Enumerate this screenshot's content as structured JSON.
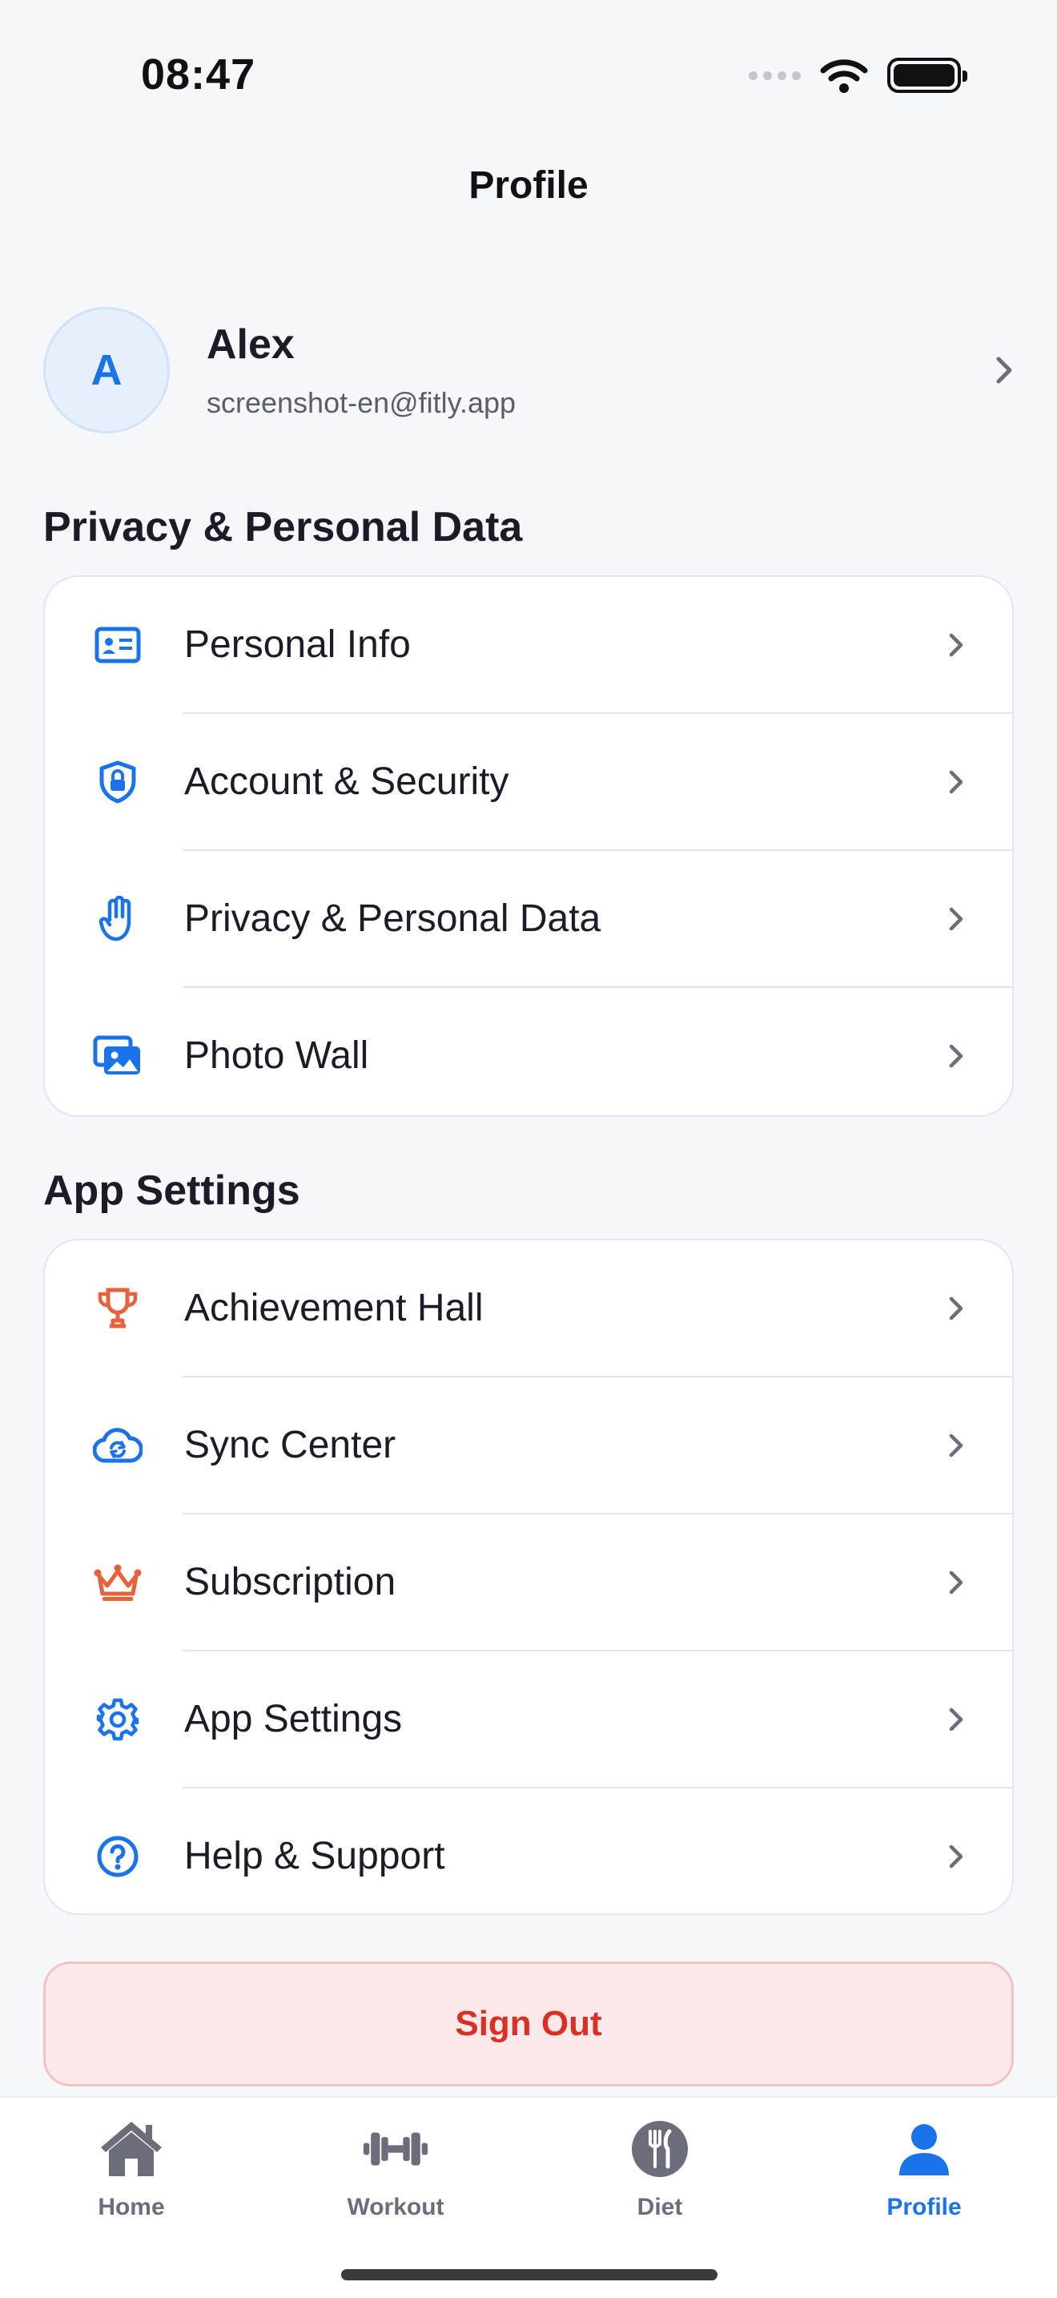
{
  "status": {
    "time": "08:47"
  },
  "header": {
    "title": "Profile"
  },
  "profile": {
    "initial": "A",
    "name": "Alex",
    "email": "screenshot-en@fitly.app"
  },
  "sections": [
    {
      "title": "Privacy & Personal Data",
      "items": [
        {
          "label": "Personal Info",
          "icon": "id-card-icon"
        },
        {
          "label": "Account & Security",
          "icon": "shield-lock-icon"
        },
        {
          "label": "Privacy & Personal Data",
          "icon": "hand-icon"
        },
        {
          "label": "Photo Wall",
          "icon": "photos-icon"
        }
      ]
    },
    {
      "title": "App Settings",
      "items": [
        {
          "label": "Achievement Hall",
          "icon": "trophy-icon"
        },
        {
          "label": "Sync Center",
          "icon": "cloud-sync-icon"
        },
        {
          "label": "Subscription",
          "icon": "crown-icon"
        },
        {
          "label": "App Settings",
          "icon": "gear-icon"
        },
        {
          "label": "Help & Support",
          "icon": "question-icon"
        }
      ]
    }
  ],
  "sign_out": {
    "label": "Sign Out"
  },
  "tabs": [
    {
      "label": "Home",
      "icon": "home-icon"
    },
    {
      "label": "Workout",
      "icon": "dumbbell-icon"
    },
    {
      "label": "Diet",
      "icon": "fork-knife-icon"
    },
    {
      "label": "Profile",
      "icon": "person-icon",
      "active": true
    }
  ],
  "colors": {
    "accent": "#1a73e8",
    "orange": "#e8603c",
    "danger": "#d93025",
    "signout_bg": "#fde9e9"
  }
}
